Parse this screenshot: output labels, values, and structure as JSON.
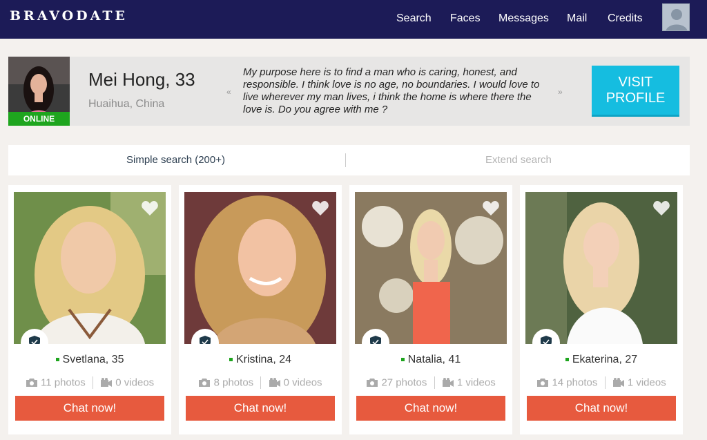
{
  "header": {
    "logo": "BRAVODATE",
    "nav": [
      "Search",
      "Faces",
      "Messages",
      "Mail",
      "Credits"
    ],
    "avatar_icon": "user-silhouette-icon"
  },
  "featured": {
    "status": "ONLINE",
    "name": "Mei Hong, 33",
    "location": "Huaihua, China",
    "prev_arrow": "«",
    "next_arrow": "»",
    "about": "My purpose here is to find a man who is caring, honest, and responsible. I think love is no age, no boundaries. I would love to live wherever my man lives, i think the home is where there the love is. Do you agree with me ?",
    "cta": "VISIT PROFILE"
  },
  "search_tabs": {
    "simple": "Simple search (200+)",
    "extend": "Extend search"
  },
  "profiles": [
    {
      "name": "Svetlana, 35",
      "photos": "11 photos",
      "videos": "0 videos",
      "cta": "Chat now!"
    },
    {
      "name": "Kristina, 24",
      "photos": "8 photos",
      "videos": "0 videos",
      "cta": "Chat now!"
    },
    {
      "name": "Natalia, 41",
      "photos": "27 photos",
      "videos": "1 videos",
      "cta": "Chat now!"
    },
    {
      "name": "Ekaterina, 27",
      "photos": "14 photos",
      "videos": "1 videos",
      "cta": "Chat now!"
    }
  ],
  "colors": {
    "header_bg": "#1c1b57",
    "online": "#1ea51e",
    "visit_button": "#15bde0",
    "chat_button": "#e75a3e"
  }
}
